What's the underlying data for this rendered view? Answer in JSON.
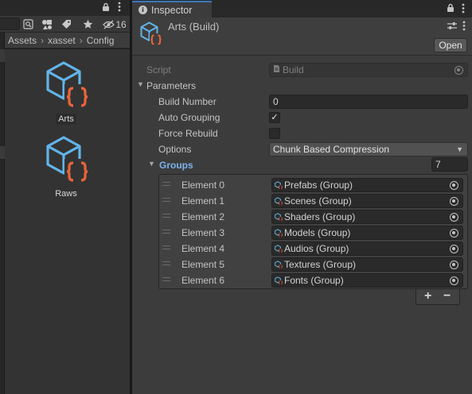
{
  "project": {
    "search_value": "",
    "hidden_count": "16",
    "breadcrumb": [
      "Assets",
      "xasset",
      "Config"
    ],
    "assets": [
      {
        "name": "Arts",
        "icon": "build-asset-icon",
        "selected": true
      },
      {
        "name": "Raws",
        "icon": "build-asset-icon",
        "selected": false
      }
    ]
  },
  "inspector": {
    "tab_label": "Inspector",
    "title": "Arts (Build)",
    "open_label": "Open",
    "script": {
      "label": "Script",
      "value": "Build"
    },
    "parameters_label": "Parameters",
    "build_number": {
      "label": "Build Number",
      "value": "0"
    },
    "auto_grouping": {
      "label": "Auto Grouping",
      "checked": true
    },
    "force_rebuild": {
      "label": "Force Rebuild",
      "checked": false
    },
    "options": {
      "label": "Options",
      "value": "Chunk Based Compression"
    },
    "groups": {
      "label": "Groups",
      "count": "7",
      "elements": [
        {
          "label": "Element 0",
          "value": "Prefabs (Group)"
        },
        {
          "label": "Element 1",
          "value": "Scenes (Group)"
        },
        {
          "label": "Element 2",
          "value": "Shaders (Group)"
        },
        {
          "label": "Element 3",
          "value": "Models (Group)"
        },
        {
          "label": "Element 4",
          "value": "Audios (Group)"
        },
        {
          "label": "Element 5",
          "value": "Textures (Group)"
        },
        {
          "label": "Element 6",
          "value": "Fonts (Group)"
        }
      ],
      "add_label": "+",
      "remove_label": "−"
    }
  },
  "colors": {
    "accent": "#7cb3ec",
    "icon_blue": "#62b4e8",
    "icon_orange": "#e8643a",
    "panel_bg": "#3c3c3c",
    "field_bg": "#2a2a2a"
  }
}
